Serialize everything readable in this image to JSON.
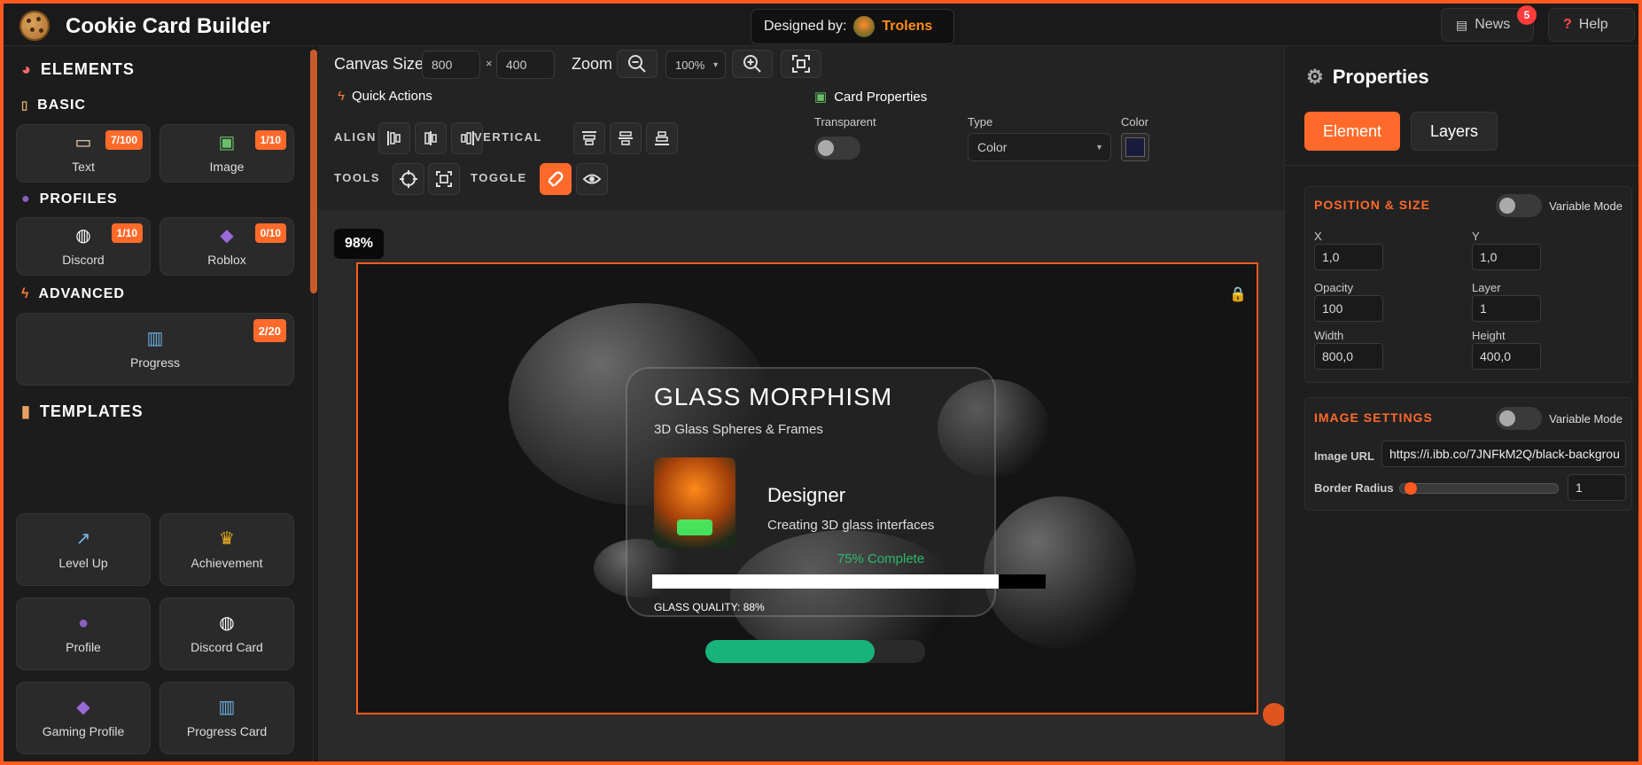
{
  "header": {
    "title": "Cookie Card Builder",
    "designed_by_label": "Designed by:",
    "designer_name": "Trolens",
    "news_label": "News",
    "news_count": "5",
    "help_label": "Help"
  },
  "sidebar": {
    "elements_title": "ELEMENTS",
    "basic_title": "BASIC",
    "basic_items": [
      {
        "label": "Text",
        "count": "7/100"
      },
      {
        "label": "Image",
        "count": "1/10"
      }
    ],
    "profiles_title": "PROFILES",
    "profile_items": [
      {
        "label": "Discord",
        "count": "1/10"
      },
      {
        "label": "Roblox",
        "count": "0/10"
      }
    ],
    "advanced_title": "ADVANCED",
    "advanced_items": [
      {
        "label": "Progress",
        "count": "2/20"
      }
    ],
    "templates_title": "TEMPLATES",
    "templates": [
      {
        "label": "Level Up"
      },
      {
        "label": "Achievement"
      },
      {
        "label": "Profile"
      },
      {
        "label": "Discord Card"
      },
      {
        "label": "Gaming Profile"
      },
      {
        "label": "Progress Card"
      }
    ]
  },
  "toolbar": {
    "canvas_size_label": "Canvas Size",
    "canvas_width": "800",
    "size_separator": "×",
    "canvas_height": "400",
    "zoom_label": "Zoom",
    "zoom_value": "100%",
    "quick_actions_label": "Quick Actions",
    "align_label": "ALIGN",
    "vertical_label": "VERTICAL",
    "tools_label": "TOOLS",
    "toggle_label": "TOGGLE",
    "card_properties_label": "Card Properties",
    "transparent_label": "Transparent",
    "type_label": "Type",
    "type_value": "Color",
    "color_label": "Color",
    "card_color": "#1a1a3a"
  },
  "canvas": {
    "zoom_indicator": "98%",
    "card_title": "GLASS MORPHISM",
    "card_subtitle": "3D Glass Spheres & Frames",
    "profile_name": "Designer",
    "profile_description": "Creating 3D glass interfaces",
    "progress_text": "75% Complete",
    "progress_fraction": 0.75,
    "quality_text": "GLASS QUALITY: 88%",
    "quality_fraction": 0.88,
    "green_bar_fraction": 0.77,
    "accent_color": "#ff5a1f",
    "progress_color": "#17b37a"
  },
  "properties": {
    "title": "Properties",
    "tab_element": "Element",
    "tab_layers": "Layers",
    "position_size_title": "POSITION & SIZE",
    "variable_mode_label": "Variable Mode",
    "x_label": "X",
    "x_value": "1,0",
    "y_label": "Y",
    "y_value": "1,0",
    "opacity_label": "Opacity",
    "opacity_value": "100",
    "layer_label": "Layer",
    "layer_value": "1",
    "width_label": "Width",
    "width_value": "800,0",
    "height_label": "Height",
    "height_value": "400,0",
    "image_settings_title": "IMAGE SETTINGS",
    "image_url_label": "Image URL",
    "image_url_value": "https://i.ibb.co/7JNFkM2Q/black-backgrou",
    "border_radius_label": "Border Radius",
    "border_radius_value": "1",
    "border_radius_fraction": 0.03
  }
}
